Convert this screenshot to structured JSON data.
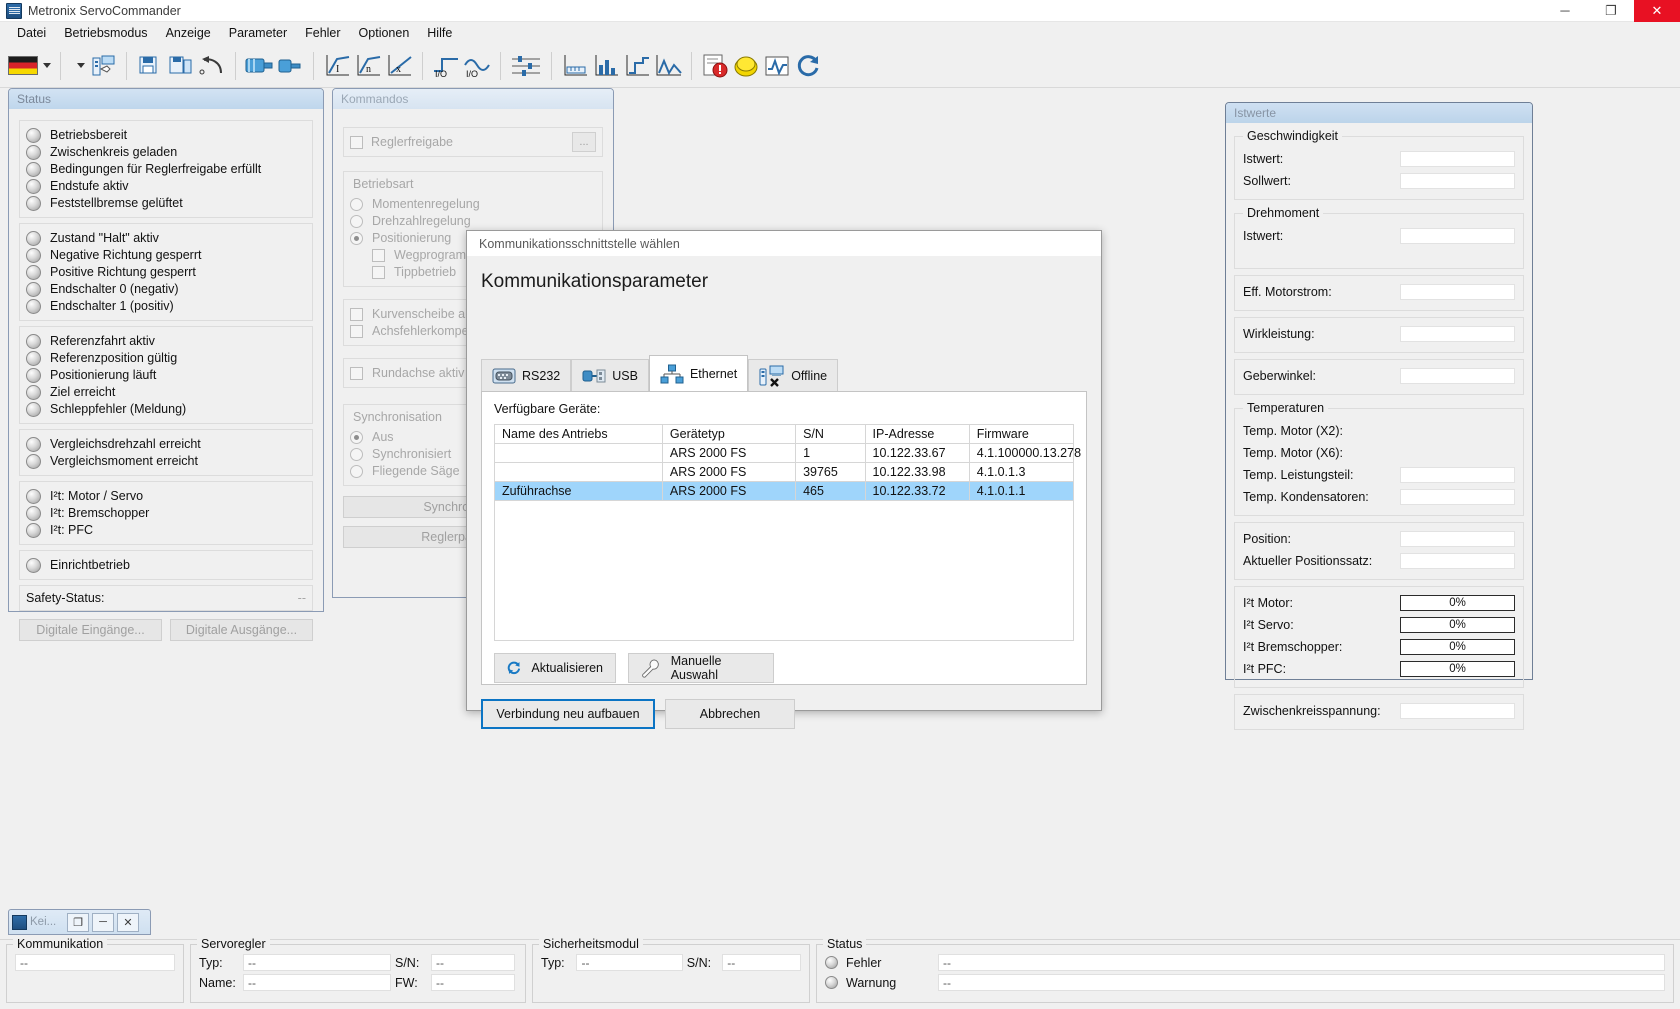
{
  "window": {
    "title": "Metronix ServoCommander",
    "icon": "app-icon",
    "minimize": "─",
    "maximize": "❐",
    "close": "✕"
  },
  "menu": {
    "items": [
      "Datei",
      "Betriebsmodus",
      "Anzeige",
      "Parameter",
      "Fehler",
      "Optionen",
      "Hilfe"
    ]
  },
  "toolbar": {
    "language_flag": "german-flag",
    "buttons": [
      "dropdown-caret",
      "device-config-icon",
      "save-icon",
      "save-as-icon",
      "undo-icon",
      "motor-icon",
      "motor-small-icon",
      "current-curve-icon",
      "speed-curve-icon",
      "position-curve-icon",
      "digital-input-icon",
      "digital-output-icon",
      "sliders-icon",
      "ruler-icon",
      "chart-bars-icon",
      "chart-step-icon",
      "chart-peak-icon",
      "error-icon",
      "emergency-stop-icon",
      "oscilloscope-icon",
      "refresh-icon"
    ]
  },
  "status_panel": {
    "caption": "Status",
    "groups": [
      {
        "items": [
          "Betriebsbereit",
          "Zwischenkreis geladen",
          "Bedingungen für Reglerfreigabe erfüllt",
          "Endstufe aktiv",
          "Feststellbremse gelüftet"
        ]
      },
      {
        "items": [
          "Zustand \"Halt\" aktiv",
          "Negative Richtung gesperrt",
          "Positive Richtung gesperrt",
          "Endschalter 0 (negativ)",
          "Endschalter 1 (positiv)"
        ]
      },
      {
        "items": [
          "Referenzfahrt aktiv",
          "Referenzposition gültig",
          "Positionierung läuft",
          "Ziel erreicht",
          "Schleppfehler (Meldung)"
        ]
      },
      {
        "items": [
          "Vergleichsdrehzahl erreicht",
          "Vergleichsmoment erreicht"
        ]
      },
      {
        "items": [
          "I²t: Motor / Servo",
          "I²t: Bremschopper",
          "I²t: PFC"
        ]
      },
      {
        "items": [
          "Einrichtbetrieb"
        ]
      }
    ],
    "safety_label": "Safety-Status:",
    "safety_value": "--",
    "button_inputs": "Digitale Eingänge...",
    "button_outputs": "Digitale Ausgänge..."
  },
  "kommandos_panel": {
    "caption": "Kommandos",
    "enable_checkbox": "Reglerfreigabe",
    "enable_more": "...",
    "mode_group": "Betriebsart",
    "modes": [
      {
        "label": "Momentenregelung",
        "selected": false
      },
      {
        "label": "Drehzahlregelung",
        "selected": false
      },
      {
        "label": "Positionierung",
        "selected": true
      }
    ],
    "sub_options": [
      "Wegprogramm",
      "Tippbetrieb"
    ],
    "checks": [
      "Kurvenscheibe aktiv",
      "Achsfehlerkompensation",
      "Rundachse aktiv"
    ],
    "sync_group": "Synchronisation",
    "sync_options": [
      {
        "label": "Aus",
        "selected": true
      },
      {
        "label": "Synchronisiert",
        "selected": false
      },
      {
        "label": "Fliegende Säge",
        "selected": false
      }
    ],
    "btn_sync": "Synchronisation...",
    "btn_regler": "Reglerparameter..."
  },
  "istwerte_panel": {
    "caption": "Istwerte",
    "groups": [
      {
        "legend": "Geschwindigkeit",
        "rows": [
          {
            "label": "Istwert:",
            "value": "",
            "type": "field"
          },
          {
            "label": "Sollwert:",
            "value": "",
            "type": "field"
          }
        ]
      },
      {
        "legend": "Drehmoment",
        "rows": [
          {
            "label": "Istwert:",
            "value": "",
            "type": "field"
          }
        ]
      },
      {
        "legend": "",
        "rows": [
          {
            "label": "Eff. Motorstrom:",
            "value": "",
            "type": "field"
          }
        ]
      },
      {
        "legend": "",
        "rows": [
          {
            "label": "Wirkleistung:",
            "value": "",
            "type": "field"
          }
        ]
      },
      {
        "legend": "",
        "rows": [
          {
            "label": "Geberwinkel:",
            "value": "",
            "type": "field"
          }
        ]
      },
      {
        "legend": "Temperaturen",
        "rows": [
          {
            "label": "Temp. Motor (X2):",
            "value": "",
            "type": "none"
          },
          {
            "label": "Temp. Motor (X6):",
            "value": "",
            "type": "none"
          },
          {
            "label": "Temp. Leistungsteil:",
            "value": "",
            "type": "field"
          },
          {
            "label": "Temp. Kondensatoren:",
            "value": "",
            "type": "field"
          }
        ]
      },
      {
        "legend": "",
        "rows": [
          {
            "label": "Position:",
            "value": "",
            "type": "field"
          },
          {
            "label": "Aktueller Positionssatz:",
            "value": "",
            "type": "field"
          }
        ]
      },
      {
        "legend": "",
        "rows": [
          {
            "label": "I²t Motor:",
            "value": "0%",
            "type": "bar"
          },
          {
            "label": "I²t Servo:",
            "value": "0%",
            "type": "bar"
          },
          {
            "label": "I²t Bremschopper:",
            "value": "0%",
            "type": "bar"
          },
          {
            "label": "I²t PFC:",
            "value": "0%",
            "type": "bar"
          }
        ]
      },
      {
        "legend": "",
        "rows": [
          {
            "label": "Zwischenkreisspannung:",
            "value": "",
            "type": "field"
          }
        ]
      }
    ]
  },
  "mini_window": {
    "title": "Kei...",
    "restore": "❐",
    "minimize": "─",
    "close": "✕"
  },
  "statusbar": {
    "kommunikation": {
      "title": "Kommunikation",
      "value": "--"
    },
    "servoregler": {
      "title": "Servoregler",
      "rows": [
        {
          "l1": "Typ:",
          "v1": "--",
          "l2": "S/N:",
          "v2": "--"
        },
        {
          "l1": "Name:",
          "v1": "--",
          "l2": "FW:",
          "v2": "--"
        }
      ]
    },
    "sicherheitsmodul": {
      "title": "Sicherheitsmodul",
      "rows": [
        {
          "l1": "Typ:",
          "v1": "--",
          "l2": "S/N:",
          "v2": "--"
        }
      ]
    },
    "status": {
      "title": "Status",
      "rows": [
        {
          "label": "Fehler",
          "value": "--"
        },
        {
          "label": "Warnung",
          "value": "--"
        }
      ]
    }
  },
  "dialog": {
    "caption": "Kommunikationsschnittstelle wählen",
    "heading": "Kommunikationsparameter",
    "tabs": [
      {
        "label": "RS232",
        "icon": "serial-port-icon",
        "active": false
      },
      {
        "label": "USB",
        "icon": "usb-icon",
        "active": false
      },
      {
        "label": "Ethernet",
        "icon": "ethernet-icon",
        "active": true
      },
      {
        "label": "Offline",
        "icon": "offline-icon",
        "active": false
      }
    ],
    "devices_label": "Verfügbare Geräte:",
    "columns": [
      "Name des Antriebs",
      "Gerätetyp",
      "S/N",
      "IP-Adresse",
      "Firmware"
    ],
    "rows": [
      {
        "name": "",
        "type": "ARS 2000 FS",
        "sn": "1",
        "ip": "10.122.33.67",
        "fw": "4.1.100000.13.278",
        "selected": false
      },
      {
        "name": "",
        "type": "ARS 2000 FS",
        "sn": "39765",
        "ip": "10.122.33.98",
        "fw": "4.1.0.1.3",
        "selected": false
      },
      {
        "name": "Zuführachse",
        "type": "ARS 2000 FS",
        "sn": "465",
        "ip": "10.122.33.72",
        "fw": "4.1.0.1.1",
        "selected": true
      }
    ],
    "btn_refresh": "Aktualisieren",
    "btn_manual": "Manuelle Auswahl",
    "btn_connect": "Verbindung neu aufbauen",
    "btn_cancel": "Abbrechen",
    "selection_color": "#9fd5fb",
    "accent_color": "#0b74c4"
  }
}
